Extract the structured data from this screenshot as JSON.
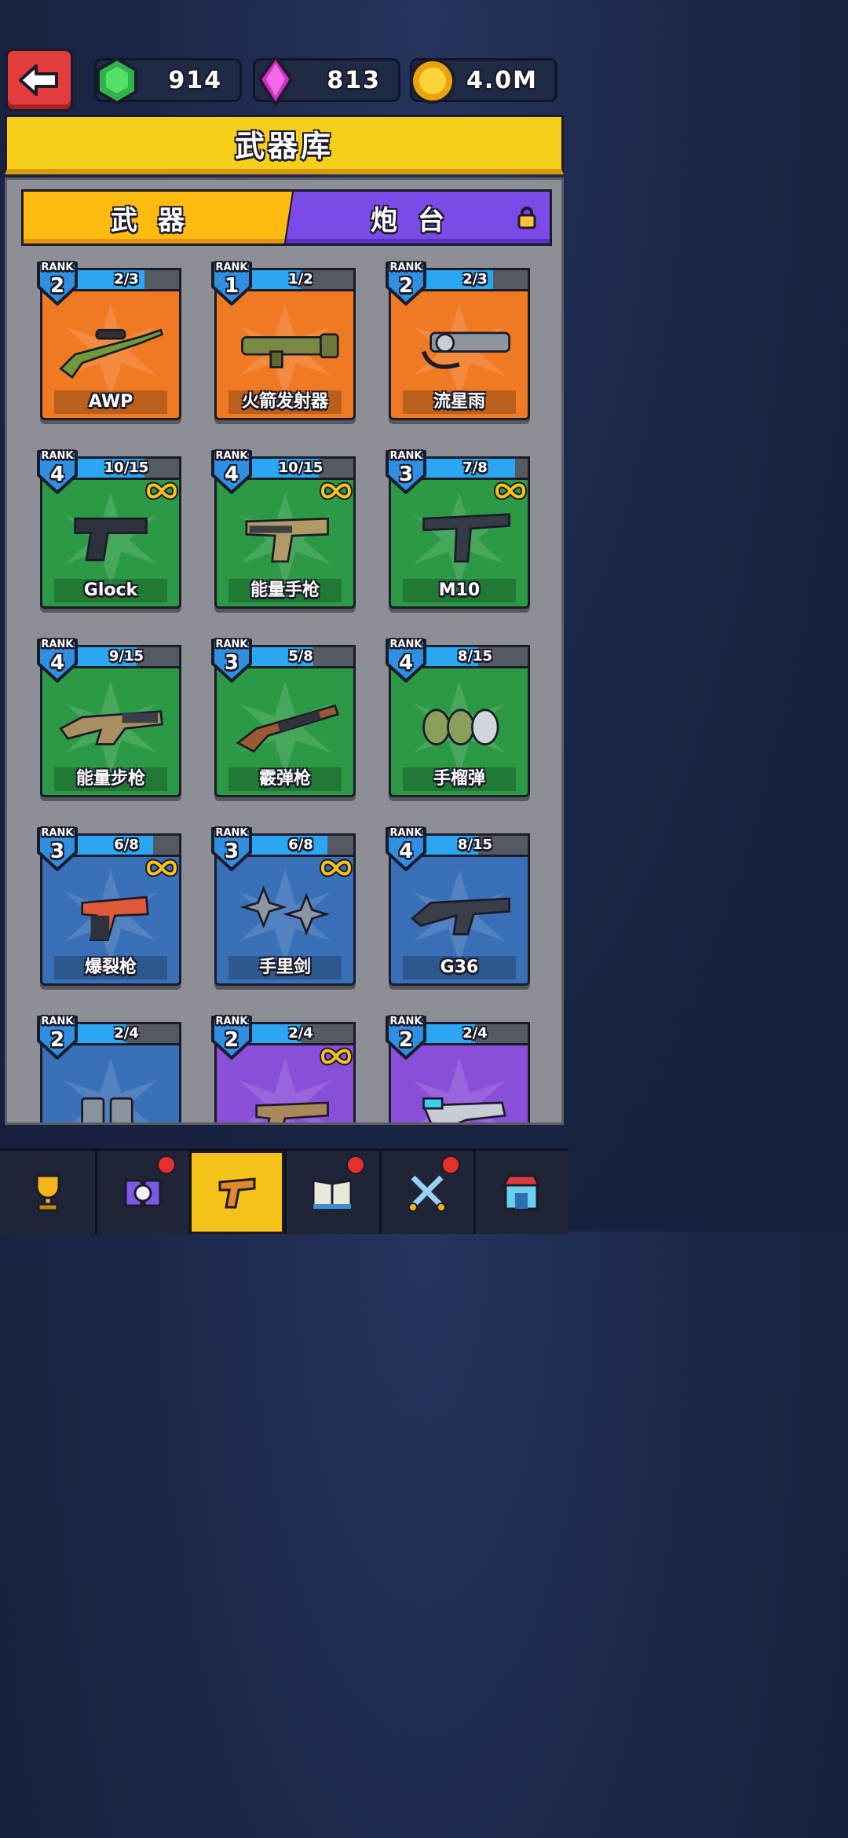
{
  "header": {
    "resources": [
      {
        "name": "emerald",
        "value": "914",
        "icon": "green-gem-icon",
        "color": "#37c74a"
      },
      {
        "name": "crystal",
        "value": "813",
        "icon": "pink-crystal-icon",
        "color": "#e23ad8"
      },
      {
        "name": "coins",
        "value": "4.0M",
        "icon": "gold-coin-icon",
        "color": "#f5b515"
      }
    ]
  },
  "title": "武器库",
  "tabs": [
    {
      "label": "武器",
      "active": true
    },
    {
      "label": "炮台",
      "active": false,
      "locked": true
    }
  ],
  "weapons": [
    {
      "rank_label": "RANK",
      "rank": "2",
      "progress": "2/3",
      "fill": 0.67,
      "name": "AWP",
      "bg": "orange",
      "infinite": false,
      "art": "sniper-rifle"
    },
    {
      "rank_label": "RANK",
      "rank": "1",
      "progress": "1/2",
      "fill": 0.5,
      "name": "火箭发射器",
      "bg": "orange",
      "infinite": false,
      "art": "rocket-launcher"
    },
    {
      "rank_label": "RANK",
      "rank": "2",
      "progress": "2/3",
      "fill": 0.67,
      "name": "流星雨",
      "bg": "orange",
      "infinite": false,
      "art": "minigun"
    },
    {
      "rank_label": "RANK",
      "rank": "4",
      "progress": "10/15",
      "fill": 0.67,
      "name": "Glock",
      "bg": "green",
      "infinite": true,
      "art": "pistol"
    },
    {
      "rank_label": "RANK",
      "rank": "4",
      "progress": "10/15",
      "fill": 0.67,
      "name": "能量手枪",
      "bg": "green",
      "infinite": true,
      "art": "energy-pistol"
    },
    {
      "rank_label": "RANK",
      "rank": "3",
      "progress": "7/8",
      "fill": 0.88,
      "name": "M10",
      "bg": "green",
      "infinite": true,
      "art": "smg"
    },
    {
      "rank_label": "RANK",
      "rank": "4",
      "progress": "9/15",
      "fill": 0.6,
      "name": "能量步枪",
      "bg": "green",
      "infinite": false,
      "art": "energy-rifle"
    },
    {
      "rank_label": "RANK",
      "rank": "3",
      "progress": "5/8",
      "fill": 0.62,
      "name": "霰弹枪",
      "bg": "green",
      "infinite": false,
      "art": "shotgun"
    },
    {
      "rank_label": "RANK",
      "rank": "4",
      "progress": "8/15",
      "fill": 0.53,
      "name": "手榴弹",
      "bg": "green",
      "infinite": false,
      "art": "grenades"
    },
    {
      "rank_label": "RANK",
      "rank": "3",
      "progress": "6/8",
      "fill": 0.75,
      "name": "爆裂枪",
      "bg": "blue",
      "infinite": true,
      "art": "flare-gun"
    },
    {
      "rank_label": "RANK",
      "rank": "3",
      "progress": "6/8",
      "fill": 0.75,
      "name": "手里剑",
      "bg": "blue",
      "infinite": true,
      "art": "shuriken"
    },
    {
      "rank_label": "RANK",
      "rank": "4",
      "progress": "8/15",
      "fill": 0.53,
      "name": "G36",
      "bg": "blue",
      "infinite": false,
      "art": "assault-rifle"
    },
    {
      "rank_label": "RANK",
      "rank": "2",
      "progress": "2/4",
      "fill": 0.5,
      "name": "",
      "bg": "blue",
      "infinite": false,
      "art": "canisters"
    },
    {
      "rank_label": "RANK",
      "rank": "2",
      "progress": "2/4",
      "fill": 0.5,
      "name": "",
      "bg": "purple",
      "infinite": true,
      "art": "revolver"
    },
    {
      "rank_label": "RANK",
      "rank": "2",
      "progress": "2/4",
      "fill": 0.5,
      "name": "",
      "bg": "purple",
      "infinite": false,
      "art": "laser-gun"
    }
  ],
  "nav": [
    {
      "name": "trophy",
      "icon": "trophy-icon",
      "active": false,
      "badge": false
    },
    {
      "name": "characters",
      "icon": "characters-icon",
      "active": false,
      "badge": true
    },
    {
      "name": "armory",
      "icon": "pistol-icon",
      "active": true,
      "badge": false
    },
    {
      "name": "codex",
      "icon": "book-icon",
      "active": false,
      "badge": true
    },
    {
      "name": "battle",
      "icon": "crossed-swords-icon",
      "active": false,
      "badge": true
    },
    {
      "name": "shop",
      "icon": "shop-icon",
      "active": false,
      "badge": false
    }
  ]
}
